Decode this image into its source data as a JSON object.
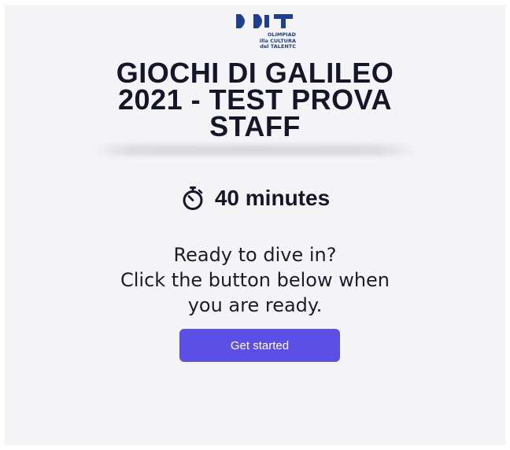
{
  "logo": {
    "line1": "OLIMPIAD",
    "line2": "illa CULTURA",
    "line3": "del TALENTC"
  },
  "title": {
    "line1": "GIOCHI DI GALILEO",
    "line2": "2021 - TEST PROVA",
    "line3": "STAFF"
  },
  "duration": {
    "icon": "timer-icon",
    "label": "40 minutes"
  },
  "message": {
    "line1": "Ready to dive in?",
    "line2": "Click the button below when",
    "line3": "you are ready."
  },
  "start_button": {
    "label": "Get started"
  },
  "colors": {
    "background": "#f4f4f7",
    "accent": "#5b4fe6",
    "text": "#16162a",
    "logo": "#1f3f8f"
  }
}
